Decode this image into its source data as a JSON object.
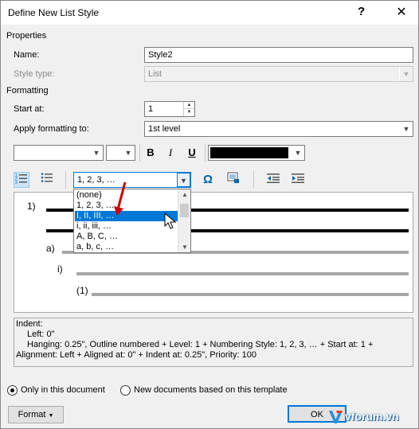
{
  "window": {
    "title": "Define New List Style",
    "help_glyph": "?",
    "close_glyph": "✕"
  },
  "properties": {
    "section_label": "Properties",
    "name_label": "Name:",
    "name_value": "Style2",
    "style_type_label": "Style type:",
    "style_type_value": "List"
  },
  "formatting": {
    "section_label": "Formatting",
    "start_at_label": "Start at:",
    "start_at_value": "1",
    "apply_to_label": "Apply formatting to:",
    "apply_to_value": "1st level",
    "font_value": "",
    "size_value": "",
    "bold": "B",
    "italic": "I",
    "underline": "U",
    "font_color": "#000000",
    "numbering_value": "1, 2, 3, …",
    "symbol_glyph": "Ω"
  },
  "number_list": {
    "options": [
      "(none)",
      "1, 2, 3, …",
      "I, II, III, …",
      "i, ii, iii, …",
      "A, B, C, …",
      "a, b, c, …"
    ],
    "selected_index": 2
  },
  "preview": {
    "levels": [
      "1)",
      "a)",
      "i)",
      "(1)"
    ]
  },
  "description": {
    "line1": "Indent:",
    "line2": "Left:  0\"",
    "line3": "Hanging:  0.25\", Outline numbered + Level: 1 + Numbering Style: 1, 2, 3, … + Start at: 1 +",
    "line4": "Alignment: Left + Aligned at:  0\" + Indent at:  0.25\", Priority: 100"
  },
  "options": {
    "only_this_doc": "Only in this document",
    "new_docs": "New documents based on this template"
  },
  "buttons": {
    "format": "Format",
    "ok": "OK"
  },
  "watermark": "vforum.vn",
  "colors": {
    "selection": "#0078d7",
    "arrow": "#cc0000",
    "accent": "#0078d7"
  }
}
